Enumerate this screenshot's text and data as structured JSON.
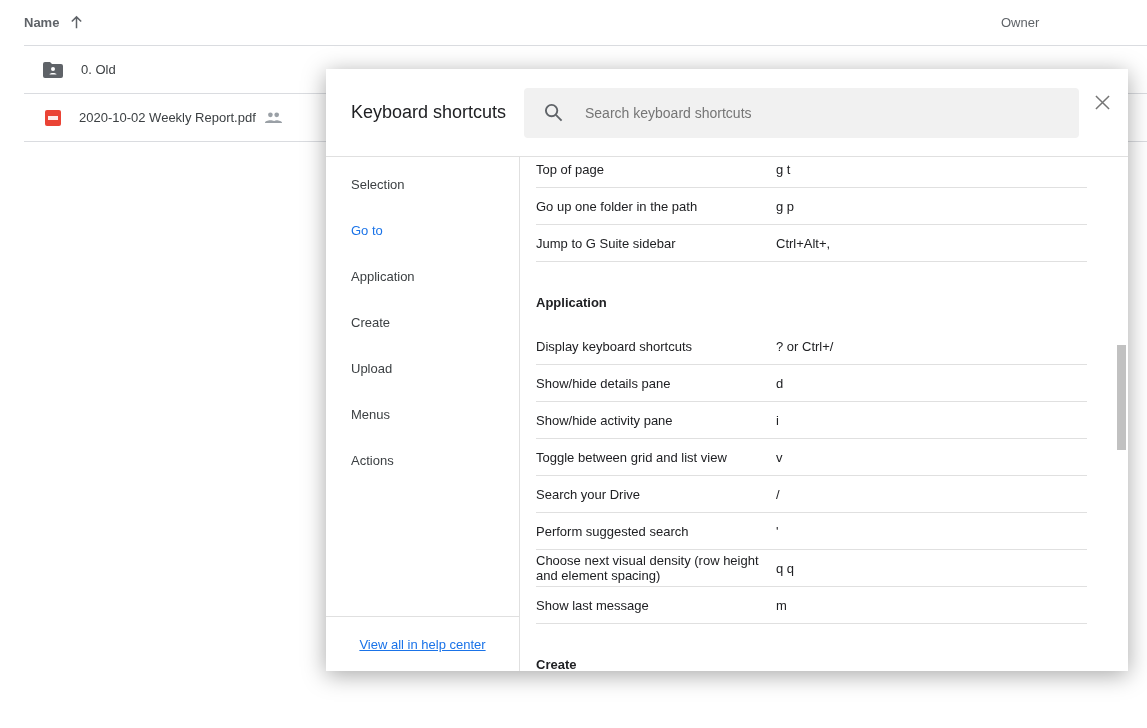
{
  "file_list": {
    "columns": {
      "name": "Name",
      "owner": "Owner"
    },
    "rows": [
      {
        "kind": "folder",
        "name": "0. Old",
        "shared": false
      },
      {
        "kind": "pdf",
        "name": "2020-10-02 Weekly Report.pdf",
        "shared": true
      }
    ]
  },
  "dialog": {
    "title": "Keyboard shortcuts",
    "search": {
      "placeholder": "Search keyboard shortcuts"
    },
    "nav": [
      {
        "label": "Selection",
        "selected": false
      },
      {
        "label": "Go to",
        "selected": true
      },
      {
        "label": "Application",
        "selected": false
      },
      {
        "label": "Create",
        "selected": false
      },
      {
        "label": "Upload",
        "selected": false
      },
      {
        "label": "Menus",
        "selected": false
      },
      {
        "label": "Actions",
        "selected": false
      }
    ],
    "help_link": "View all in help center",
    "items": [
      {
        "kind": "row",
        "action": "Top of page",
        "keys": "g t"
      },
      {
        "kind": "row",
        "action": "Go up one folder in the path",
        "keys": "g p"
      },
      {
        "kind": "row",
        "action": "Jump to G Suite sidebar",
        "keys": "Ctrl+Alt+,"
      },
      {
        "kind": "heading",
        "title": "Application"
      },
      {
        "kind": "row",
        "action": "Display keyboard shortcuts",
        "keys": "? or Ctrl+/"
      },
      {
        "kind": "row",
        "action": "Show/hide details pane",
        "keys": "d"
      },
      {
        "kind": "row",
        "action": "Show/hide activity pane",
        "keys": "i"
      },
      {
        "kind": "row",
        "action": "Toggle between grid and list view",
        "keys": "v"
      },
      {
        "kind": "row",
        "action": "Search your Drive",
        "keys": "/"
      },
      {
        "kind": "row",
        "action": "Perform suggested search",
        "keys": "'"
      },
      {
        "kind": "row",
        "action": "Choose next visual density (row height and element spacing)",
        "keys": "q q"
      },
      {
        "kind": "row",
        "action": "Show last message",
        "keys": "m"
      },
      {
        "kind": "heading",
        "title": "Create"
      }
    ]
  }
}
